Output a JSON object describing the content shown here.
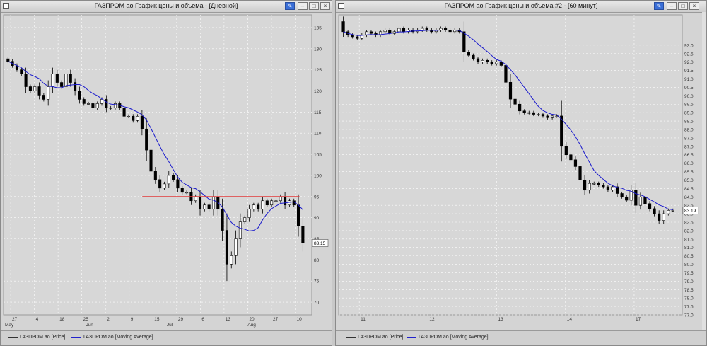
{
  "colors": {
    "up": "#ffffff",
    "down": "#000000",
    "ma": "#1a1acc",
    "hline": "#e23a3a",
    "grid": "#ffffff",
    "plot_bg": "#d7d7d7"
  },
  "left": {
    "title": "ГАЗПРОМ ао График цены и объема - [Дневной]",
    "legend_price": "ГАЗПРОМ ао [Price]",
    "legend_ma": "ГАЗПРОМ ао [Moving Average]",
    "last_value": "83.15",
    "icons": [
      "chart-window-icon",
      "pin-icon",
      "minimize-icon",
      "maximize-icon",
      "close-icon"
    ]
  },
  "right": {
    "title": "ГАЗПРОМ ао График цены и объема #2 - [60 минут]",
    "legend_price": "ГАЗПРОМ ао [Price]",
    "legend_ma": "ГАЗПРОМ ао [Moving Average]",
    "last_value": "83.19",
    "icons": [
      "chart-window-icon",
      "pin-icon",
      "minimize-icon",
      "maximize-icon",
      "close-icon"
    ]
  },
  "chart_data": [
    {
      "type": "candlestick",
      "ylim": [
        67,
        138
      ],
      "yticks": [
        "135",
        "130",
        "125",
        "120",
        "115",
        "110",
        "105",
        "100",
        "95",
        "90",
        "85",
        "80",
        "75",
        "70"
      ],
      "xticks_top": [
        "27",
        "4",
        "18",
        "25",
        "2",
        "9",
        "15",
        "29",
        "6",
        "13",
        "20",
        "27",
        "10"
      ],
      "xticks_bottom": [
        "May",
        "Jun",
        "Jul",
        "Aug"
      ],
      "grid": true,
      "horizontal_line_value": 95,
      "close_series": [
        127,
        126,
        125,
        124,
        121,
        120,
        121,
        119,
        118,
        121,
        124,
        122,
        121,
        124,
        122,
        120,
        118,
        117,
        117,
        116,
        117,
        118,
        116,
        116,
        117,
        116,
        114,
        114,
        113,
        114,
        111,
        106,
        101,
        99,
        97,
        98,
        100,
        99,
        97,
        96,
        96,
        94,
        95,
        92,
        93,
        92,
        95,
        92,
        87,
        79,
        81,
        85,
        89,
        90,
        92,
        93,
        92,
        94,
        93,
        94,
        94,
        95,
        93,
        94,
        93,
        88,
        84
      ]
    },
    {
      "type": "candlestick",
      "ylim": [
        77,
        94.8
      ],
      "yticks": [
        "93.0",
        "92.5",
        "92.0",
        "91.5",
        "91.0",
        "90.5",
        "90.0",
        "89.5",
        "89.0",
        "88.5",
        "88.0",
        "87.5",
        "87.0",
        "86.5",
        "86.0",
        "85.5",
        "85.0",
        "84.5",
        "84.0",
        "83.5",
        "83.0",
        "82.5",
        "82.0",
        "81.5",
        "81.0",
        "80.5",
        "80.0",
        "79.5",
        "79.0",
        "78.5",
        "78.0",
        "77.5",
        "77.0"
      ],
      "xticks": [
        "11",
        "12",
        "13",
        "14",
        "17"
      ],
      "grid": true,
      "close_series": [
        93.8,
        93.6,
        93.5,
        93.4,
        93.6,
        93.8,
        93.7,
        93.6,
        93.8,
        93.9,
        93.7,
        93.8,
        94.0,
        93.8,
        93.9,
        93.8,
        93.9,
        94.0,
        93.9,
        93.8,
        93.9,
        94.0,
        93.9,
        93.8,
        93.9,
        93.8,
        92.6,
        92.4,
        92.2,
        92.0,
        92.1,
        92.0,
        91.9,
        92.0,
        91.8,
        90.8,
        89.8,
        89.5,
        89.1,
        89.0,
        89.0,
        88.9,
        88.9,
        88.8,
        88.7,
        88.8,
        88.8,
        87.0,
        86.5,
        86.2,
        85.8,
        85.0,
        84.4,
        84.8,
        84.8,
        84.7,
        84.6,
        84.4,
        84.6,
        84.2,
        84.0,
        83.8,
        84.4,
        83.5,
        84.0,
        83.6,
        83.3,
        83.0,
        82.6,
        83.0,
        83.2,
        83.2
      ]
    }
  ]
}
